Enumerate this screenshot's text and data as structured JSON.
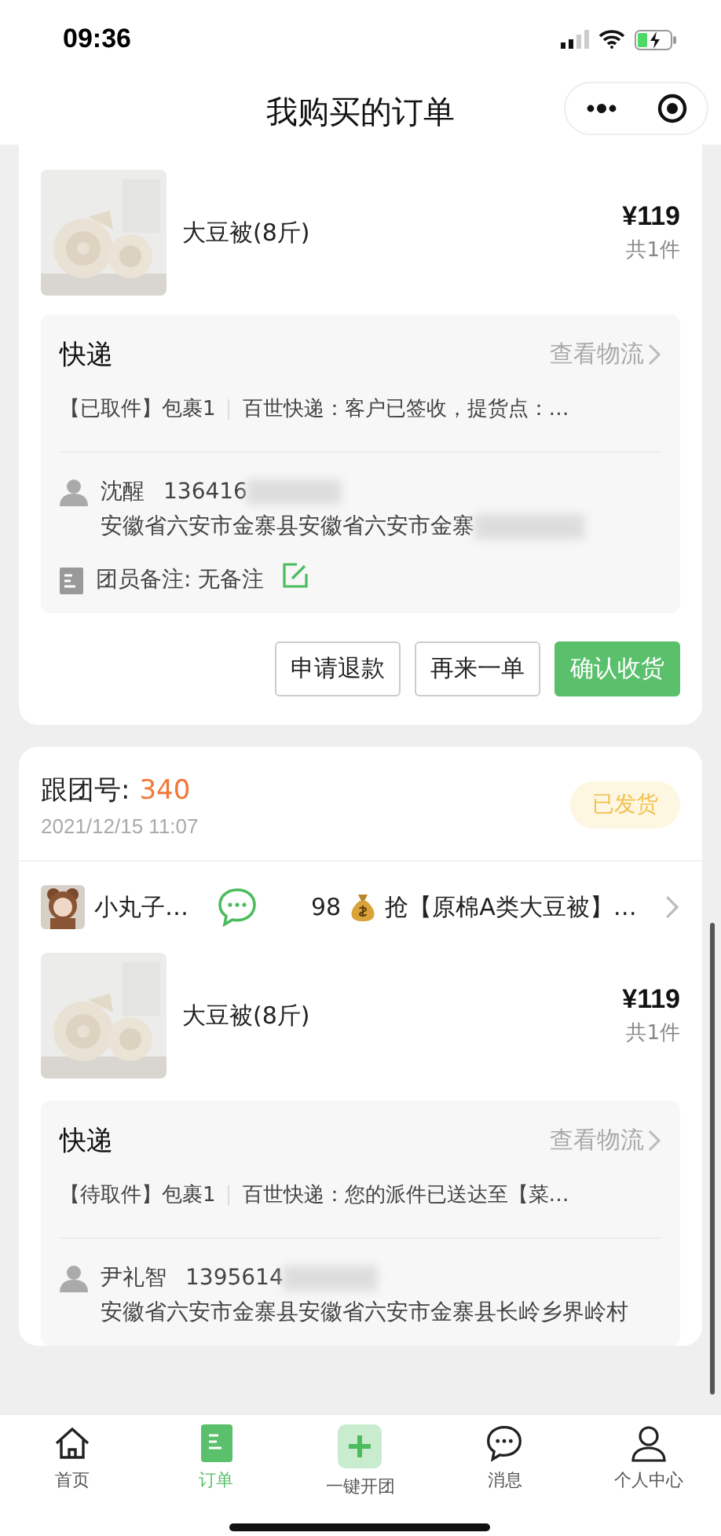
{
  "status_bar": {
    "time": "09:36"
  },
  "nav": {
    "title": "我购买的订单"
  },
  "orders": [
    {
      "product": {
        "name": "大豆被(8斤)",
        "price": "¥119",
        "count": "共1件"
      },
      "logistics": {
        "title": "快递",
        "link": "查看物流",
        "status": "【已取件】包裹1",
        "detail": "百世快递：客户已签收，提货点：…",
        "name": "沈醒",
        "phone": "136416",
        "address": "安徽省六安市金寨县安徽省六安市金寨",
        "note": "团员备注: 无备注"
      },
      "buttons": [
        {
          "label": "申请退款",
          "kind": "outline"
        },
        {
          "label": "再来一单",
          "kind": "outline"
        },
        {
          "label": "确认收货",
          "kind": "primary"
        }
      ]
    },
    {
      "header": {
        "label": "跟团号:",
        "number": "340",
        "date": "2021/12/15 11:07",
        "status": "已发货"
      },
      "leader": {
        "name": "小丸子…",
        "price": "98",
        "title": "抢【原棉A类大豆被】…"
      },
      "product": {
        "name": "大豆被(8斤)",
        "price": "¥119",
        "count": "共1件"
      },
      "logistics": {
        "title": "快递",
        "link": "查看物流",
        "status": "【待取件】包裹1",
        "detail": "百世快递：您的派件已送达至【菜…",
        "name": "尹礼智",
        "phone": "1395614",
        "address": "安徽省六安市金寨县安徽省六安市金寨县长岭乡界岭村"
      }
    }
  ],
  "tabbar": [
    {
      "label": "首页",
      "kind": "home",
      "selected": false
    },
    {
      "label": "订单",
      "kind": "orders",
      "selected": true
    },
    {
      "label": "一键开团",
      "kind": "plus",
      "selected": false
    },
    {
      "label": "消息",
      "kind": "chat",
      "selected": false
    },
    {
      "label": "个人中心",
      "kind": "person",
      "selected": false
    }
  ]
}
